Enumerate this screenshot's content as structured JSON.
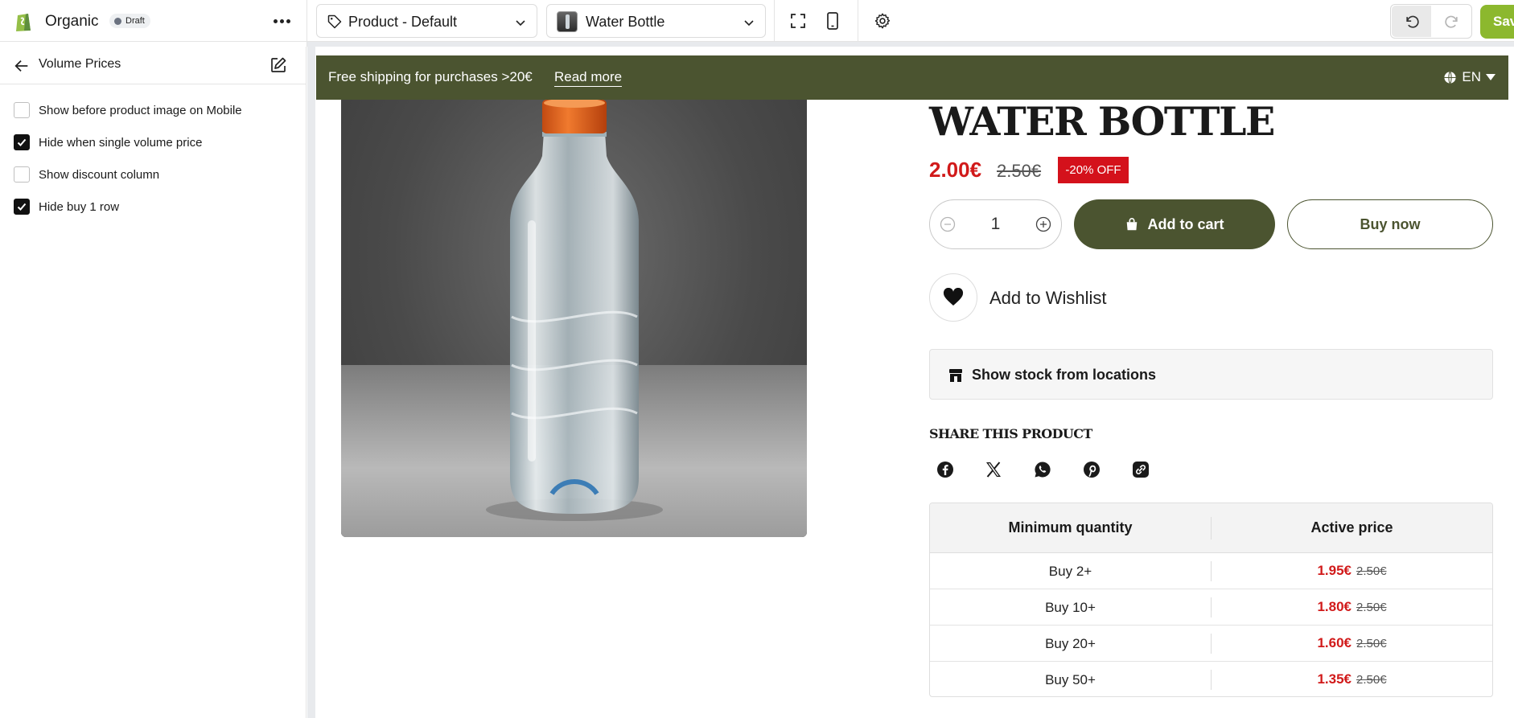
{
  "app": {
    "name": "Organic",
    "status": "Draft"
  },
  "toolbar": {
    "template_select": "Product - Default",
    "product_select": "Water Bottle",
    "save_label": "Save"
  },
  "sidebar": {
    "title": "Volume Prices",
    "options": [
      {
        "label": "Show before product image on Mobile",
        "checked": false
      },
      {
        "label": "Hide when single volume price",
        "checked": true
      },
      {
        "label": "Show discount column",
        "checked": false
      },
      {
        "label": "Hide buy 1 row",
        "checked": true
      }
    ]
  },
  "announcement": {
    "text": "Free shipping for purchases >20€",
    "link": "Read more",
    "language": "EN"
  },
  "product": {
    "title": "WATER BOTTLE",
    "price": "2.00€",
    "compare_price": "2.50€",
    "discount_badge": "-20% OFF",
    "quantity": "1",
    "add_to_cart": "Add to cart",
    "buy_now": "Buy now",
    "wishlist": "Add to Wishlist",
    "stock_locations": "Show stock from locations",
    "share_title": "SHARE THIS PRODUCT",
    "share_icons": [
      "facebook-icon",
      "x-icon",
      "whatsapp-icon",
      "pinterest-icon",
      "copy-link-icon"
    ]
  },
  "volume_table": {
    "headers": [
      "Minimum quantity",
      "Active price"
    ],
    "rows": [
      {
        "quantity": "Buy 2+",
        "active": "1.95€",
        "original": "2.50€"
      },
      {
        "quantity": "Buy 10+",
        "active": "1.80€",
        "original": "2.50€"
      },
      {
        "quantity": "Buy 20+",
        "active": "1.60€",
        "original": "2.50€"
      },
      {
        "quantity": "Buy 50+",
        "active": "1.35€",
        "original": "2.50€"
      }
    ]
  },
  "colors": {
    "brand_green": "#4b5430",
    "save_green": "#8cb82e",
    "sale_red": "#d11a1a"
  }
}
